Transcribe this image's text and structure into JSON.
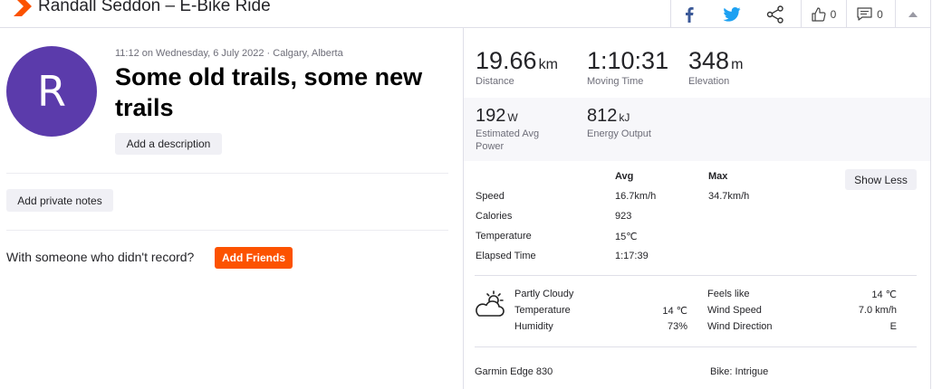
{
  "header": {
    "title": "Randall Seddon – E-Bike Ride",
    "kudos_count": "0",
    "comments_count": "0"
  },
  "activity": {
    "avatar_letter": "R",
    "meta": "11:12 on Wednesday, 6 July 2022 · Calgary, Alberta",
    "title": "Some old trails, some new trails",
    "add_description": "Add a description",
    "add_private_notes": "Add private notes",
    "friends_question": "With someone who didn't record?",
    "add_friends": "Add Friends"
  },
  "stats": {
    "distance": {
      "value": "19.66",
      "unit": "km",
      "label": "Distance"
    },
    "moving_time": {
      "value": "1:10:31",
      "label": "Moving Time"
    },
    "elevation": {
      "value": "348",
      "unit": "m",
      "label": "Elevation"
    },
    "power": {
      "value": "192",
      "unit": "W",
      "label": "Estimated Avg Power"
    },
    "energy": {
      "value": "812",
      "unit": "kJ",
      "label": "Energy Output"
    }
  },
  "table": {
    "col_avg": "Avg",
    "col_max": "Max",
    "show_less": "Show Less",
    "rows": [
      {
        "label": "Speed",
        "avg": "16.7km/h",
        "max": "34.7km/h"
      },
      {
        "label": "Calories",
        "avg": "923",
        "max": ""
      },
      {
        "label": "Temperature",
        "avg": "15℃",
        "max": ""
      },
      {
        "label": "Elapsed Time",
        "avg": "1:17:39",
        "max": ""
      }
    ]
  },
  "weather": {
    "condition": "Partly Cloudy",
    "temperature_label": "Temperature",
    "temperature_value": "14 ℃",
    "humidity_label": "Humidity",
    "humidity_value": "73%",
    "feels_like_label": "Feels like",
    "feels_like_value": "14 ℃",
    "wind_speed_label": "Wind Speed",
    "wind_speed_value": "7.0 km/h",
    "wind_direction_label": "Wind Direction",
    "wind_direction_value": "E"
  },
  "gear": {
    "device": "Garmin Edge 830",
    "bike": "Bike: Intrigue"
  },
  "colors": {
    "brand": "#fc5200",
    "avatar": "#5b3bab",
    "facebook": "#3b5998",
    "twitter": "#1da1f2"
  },
  "icons": [
    "strava-chevron-icon",
    "facebook-icon",
    "twitter-icon",
    "share-icon",
    "thumbs-up-icon",
    "comment-icon",
    "collapse-up-icon",
    "partly-cloudy-icon"
  ]
}
